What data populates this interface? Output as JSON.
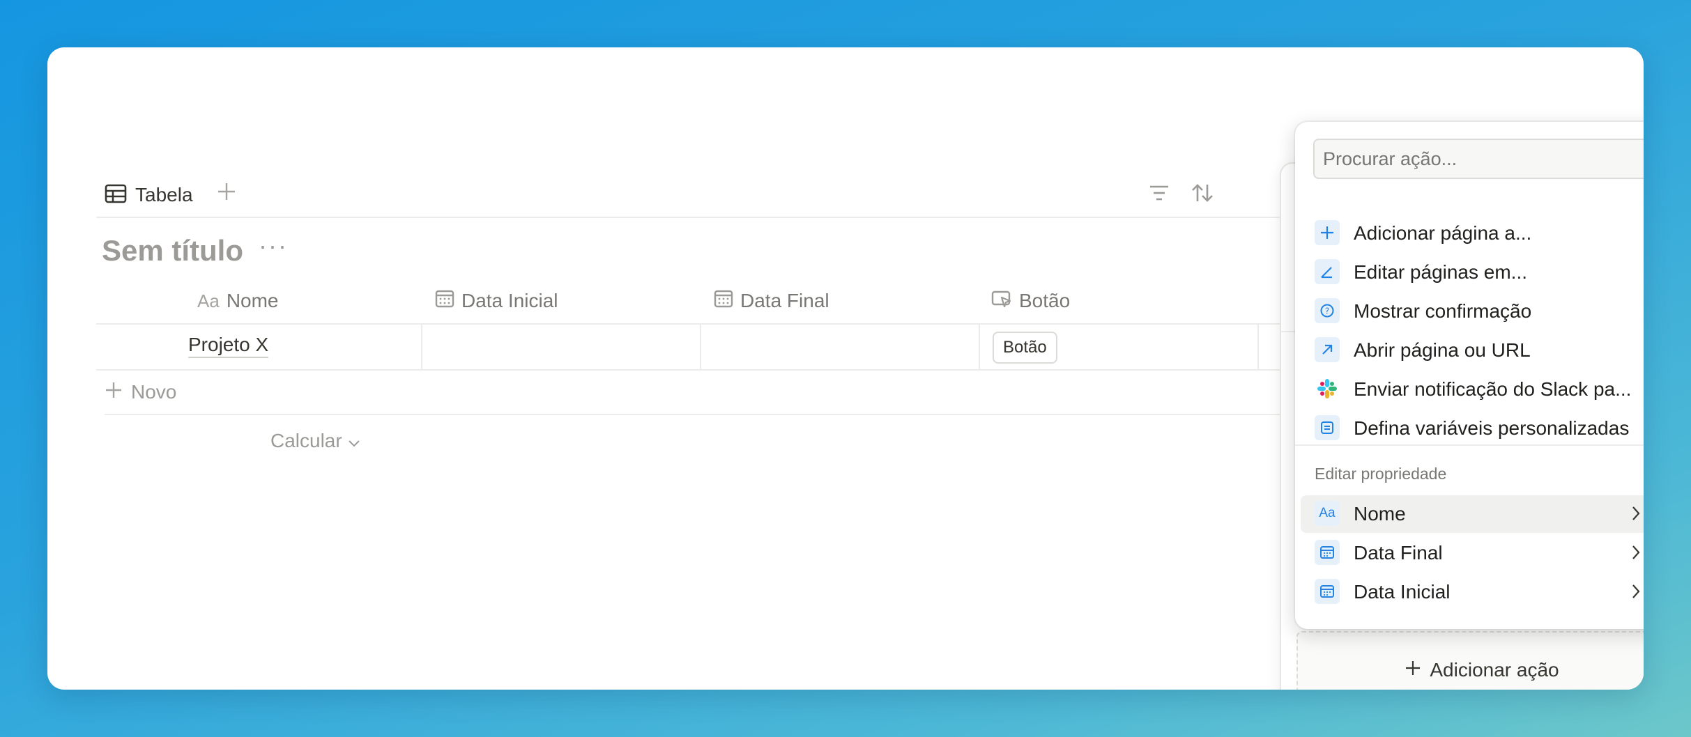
{
  "table": {
    "view_tab_label": "Tabela",
    "title": "Sem título",
    "more": "···",
    "columns": [
      {
        "label": "Nome",
        "icon": "text-property-icon",
        "prefix": "Aa"
      },
      {
        "label": "Data Inicial",
        "icon": "calendar-icon"
      },
      {
        "label": "Data Final",
        "icon": "calendar-icon"
      },
      {
        "label": "Botão",
        "icon": "button-property-icon"
      }
    ],
    "rows": [
      {
        "name": "Projeto X",
        "button_label": "Botão"
      }
    ],
    "new_row_label": "Novo",
    "calculate_label": "Calcular"
  },
  "panel": {
    "add_action_label": "Adicionar ação"
  },
  "action_menu": {
    "search_placeholder": "Procurar ação...",
    "actions": [
      {
        "label": "Adicionar página a...",
        "icon": "plus-icon"
      },
      {
        "label": "Editar páginas em...",
        "icon": "edit-icon"
      },
      {
        "label": "Mostrar confirmação",
        "icon": "question-icon"
      },
      {
        "label": "Abrir página ou URL",
        "icon": "arrow-up-right-icon"
      },
      {
        "label": "Enviar notificação do Slack pa...",
        "icon": "slack-icon"
      },
      {
        "label": "Defina variáveis personalizadas",
        "icon": "variables-icon"
      }
    ],
    "section_label": "Editar propriedade",
    "properties": [
      {
        "label": "Nome",
        "icon": "text-property-icon",
        "prefix": "Aa",
        "highlighted": true
      },
      {
        "label": "Data Final",
        "icon": "calendar-icon"
      },
      {
        "label": "Data Inicial",
        "icon": "calendar-icon"
      }
    ]
  },
  "colors": {
    "accent": "#2383e2",
    "icon_bg": "#e6f0fa",
    "muted_text": "#9b9a97"
  }
}
